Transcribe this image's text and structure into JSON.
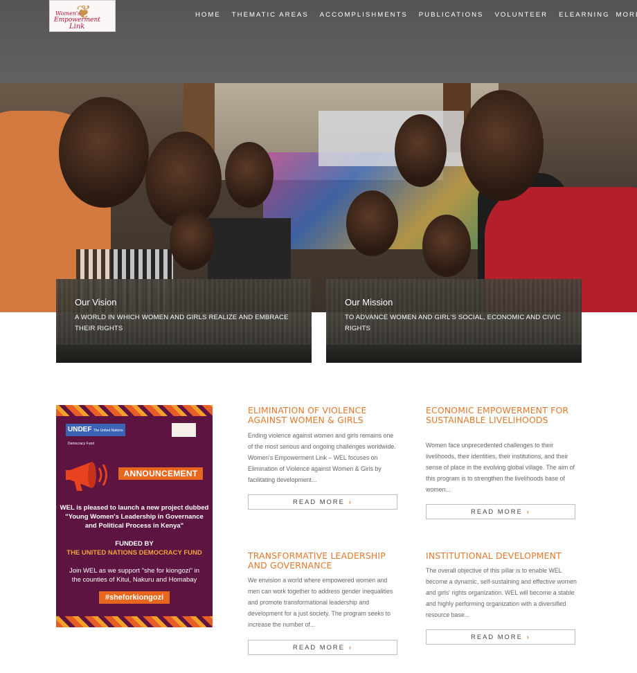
{
  "logo": {
    "line1": "Women's",
    "line2": "Empowerment",
    "line3": "Link"
  },
  "nav": {
    "items": [
      "HOME",
      "THEMATIC AREAS",
      "ACCOMPLISHMENTS",
      "PUBLICATIONS",
      "VOLUNTEER",
      "ELEARNING",
      "MORE"
    ]
  },
  "vision": {
    "title": "Our Vision",
    "text": "A WORLD IN WHICH WOMEN AND GIRLS REALIZE AND EMBRACE THEIR RIGHTS"
  },
  "mission": {
    "title": "Our Mission",
    "text": "TO ADVANCE WOMEN AND GIRL'S SOCIAL, ECONOMIC AND CIVIC RIGHTS"
  },
  "poster": {
    "undef": "UNDEF",
    "undef_sub": "The United Nations Democracy Fund",
    "announcement": "ANNOUNCEMENT",
    "line1": "WEL is pleased to launch a new project dubbed",
    "line2": "\"Young Women's Leadership in Governance",
    "line3": "and Political Process in Kenya\"",
    "funded": "FUNDED BY",
    "fund_name": "THE UNITED NATIONS DEMOCRACY FUND",
    "join1": "Join WEL as we support \"she for kiongozi\" in",
    "join2": "the counties of Kitui, Nakuru and Homabay",
    "hashtag": "#sheforkiongozi"
  },
  "programs": {
    "evaw": {
      "title": "ELIMINATION OF VIOLENCE AGAINST WOMEN & GIRLS",
      "text": "Ending violence against women and girls remains one of the most serious and ongoing challenges worldwide. Women's Empowerment Link – WEL focuses on Elimination of Violence against Women & Girls by facilitating development..."
    },
    "econ": {
      "title": "ECONOMIC EMPOWERMENT FOR SUSTAINABLE LIVELIHOODS",
      "text": "Women face unprecedented challenges to their livelihoods, their identities, their institutions, and their sense of place in the evolving global village. The aim of this program is to strengthen the livelihoods base of women..."
    },
    "lead": {
      "title": "TRANSFORMATIVE LEADERSHIP AND GOVERNANCE",
      "text": "We envision a world where empowered women and men can work together to address gender inequalities and promote transformational leadership and development for a just society. The program seeks to increase the number of..."
    },
    "inst": {
      "title": "INSTITUTIONAL DEVELOPMENT",
      "text": "The overall objective of this pillar is to enable WEL become a dynamic, self-sustaining and effective women and girls' rights organization. WEL will become a stable and highly performing organization with a diversified resource base..."
    }
  },
  "read_more": "READ MORE",
  "colors": {
    "accent": "#e4772a",
    "header": "#5c5c5c",
    "poster_bg": "#5d1440"
  }
}
